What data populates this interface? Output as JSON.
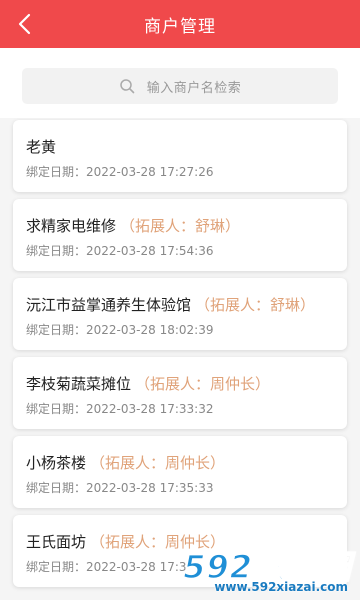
{
  "header": {
    "title": "商户管理",
    "back_icon": "chevron-left-icon"
  },
  "search": {
    "placeholder": "输入商户名检索",
    "icon": "search-icon"
  },
  "merchants": [
    {
      "name": "老黄",
      "extension": "",
      "date_label": "绑定日期：",
      "date": "2022-03-28 17:27:26"
    },
    {
      "name": "求精家电维修",
      "extension": "（拓展人：舒琳）",
      "date_label": "绑定日期：",
      "date": "2022-03-28 17:54:36"
    },
    {
      "name": "沅江市益掌通养生体验馆",
      "extension": "（拓展人：舒琳）",
      "date_label": "绑定日期：",
      "date": "2022-03-28 18:02:39"
    },
    {
      "name": "李枝菊蔬菜摊位",
      "extension": "（拓展人：周仲长）",
      "date_label": "绑定日期：",
      "date": "2022-03-28 17:33:32"
    },
    {
      "name": "小杨茶楼",
      "extension": "（拓展人：周仲长）",
      "date_label": "绑定日期：",
      "date": "2022-03-28 17:35:33"
    },
    {
      "name": "王氏面坊",
      "extension": "（拓展人：周仲长）",
      "date_label": "绑定日期：",
      "date": "2022-03-28 17:3"
    }
  ],
  "watermark": {
    "logo_text": "592软件园",
    "url": "www.592xiazai.com"
  },
  "colors": {
    "header_bg": "#f0494b",
    "extension_text": "#e0a37a",
    "watermark_blue": "#1f8fd6"
  }
}
